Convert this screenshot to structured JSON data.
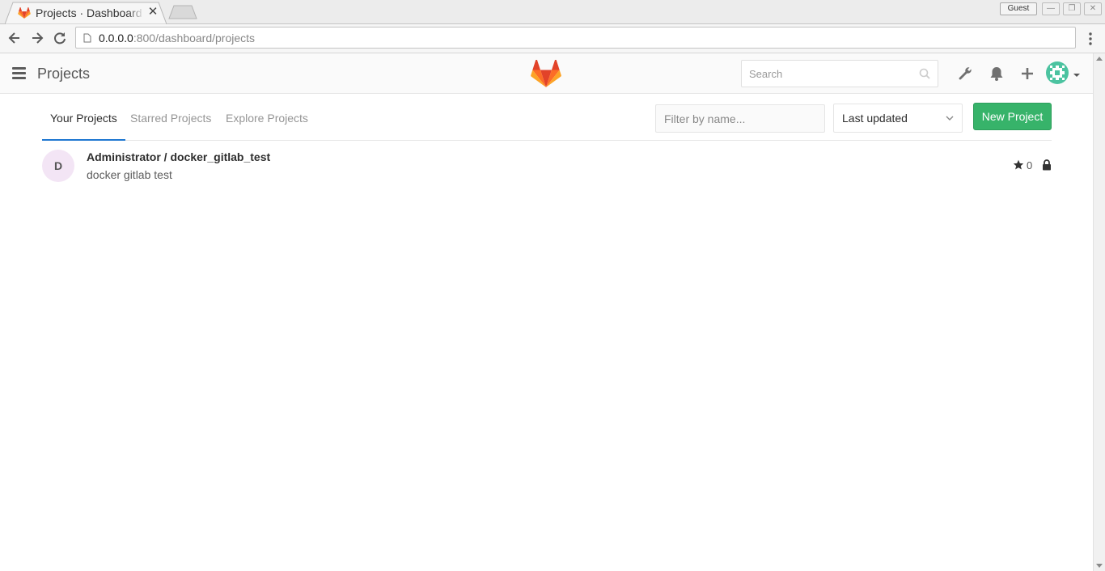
{
  "browser": {
    "tab_title": "Projects · Dashboard",
    "guest_label": "Guest",
    "url_host": "0.0.0.0",
    "url_path": ":800/dashboard/projects"
  },
  "header": {
    "title": "Projects",
    "search_placeholder": "Search"
  },
  "nav": {
    "tabs": [
      {
        "label": "Your Projects",
        "active": true
      },
      {
        "label": "Starred Projects",
        "active": false
      },
      {
        "label": "Explore Projects",
        "active": false
      }
    ],
    "filter_placeholder": "Filter by name...",
    "sort_selected": "Last updated",
    "new_project_label": "New Project"
  },
  "projects": [
    {
      "avatar_letter": "D",
      "name": "Administrator / docker_gitlab_test",
      "description": "docker gitlab test",
      "stars": "0",
      "visibility_icon": "lock-icon"
    }
  ],
  "colors": {
    "accent": "#1f78d1",
    "primary_button": "#37b36a",
    "logo_orange": "#e24329"
  }
}
